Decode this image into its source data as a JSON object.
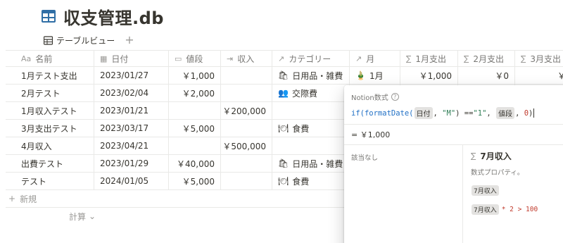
{
  "db": {
    "title": "収支管理.db",
    "icon": "table-icon"
  },
  "views": {
    "tab_label": "テーブルビュー",
    "add_label": "+"
  },
  "columns": [
    {
      "icon": "Aa",
      "label": "名前"
    },
    {
      "icon": "▦",
      "label": "日付"
    },
    {
      "icon": "▭",
      "label": "値段"
    },
    {
      "icon": "⇥",
      "label": "収入"
    },
    {
      "icon": "↗",
      "label": "カテゴリー"
    },
    {
      "icon": "↗",
      "label": "月"
    },
    {
      "icon": "∑",
      "label": "1月支出"
    },
    {
      "icon": "∑",
      "label": "2月支出"
    },
    {
      "icon": "∑",
      "label": "3月支出"
    }
  ],
  "rows": [
    {
      "name": "1月テスト支出",
      "date": "2023/01/27",
      "price": "￥1,000",
      "income": "",
      "category": "日用品・雑費",
      "category_emoji": "🛍",
      "month": "1月",
      "month_emoji": "🎍",
      "sum1": "￥1,000",
      "sum2": "￥0",
      "sum3": "￥"
    },
    {
      "name": "2月テスト",
      "date": "2023/02/04",
      "price": "￥2,000",
      "income": "",
      "category": "交際費",
      "category_emoji": "👥",
      "month": "",
      "month_emoji": "",
      "sum1": "",
      "sum2": "",
      "sum3": ""
    },
    {
      "name": "1月収入テスト",
      "date": "2023/01/21",
      "price": "",
      "income": "￥200,000",
      "category": "",
      "category_emoji": "",
      "month": "",
      "month_emoji": "",
      "sum1": "",
      "sum2": "",
      "sum3": ""
    },
    {
      "name": "3月支出テスト",
      "date": "2023/03/17",
      "price": "￥5,000",
      "income": "",
      "category": "食費",
      "category_emoji": "🍽",
      "month": "",
      "month_emoji": "",
      "sum1": "",
      "sum2": "",
      "sum3": ""
    },
    {
      "name": "4月収入",
      "date": "2023/04/21",
      "price": "",
      "income": "￥500,000",
      "category": "",
      "category_emoji": "",
      "month": "",
      "month_emoji": "",
      "sum1": "",
      "sum2": "",
      "sum3": ""
    },
    {
      "name": "出費テスト",
      "date": "2023/01/29",
      "price": "￥40,000",
      "income": "",
      "category": "日用品・雑費",
      "category_emoji": "🛍",
      "month": "",
      "month_emoji": "",
      "sum1": "",
      "sum2": "",
      "sum3": ""
    },
    {
      "name": "テスト",
      "date": "2024/01/05",
      "price": "￥5,000",
      "income": "",
      "category": "食費",
      "category_emoji": "🍽",
      "month": "",
      "month_emoji": "",
      "sum1": "",
      "sum2": "",
      "sum3": ""
    }
  ],
  "new_row_label": "新規",
  "calc_label": "計算",
  "formula_popup": {
    "title": "Notion数式",
    "formula_parts": {
      "fn_if": "if(",
      "fn_format": "formatDate(",
      "prop_date": "日付",
      "str_m": "\"M\"",
      "eq": ") == ",
      "str_1": "\"1\"",
      "prop_price": "値段",
      "zero": "0",
      "close": ")"
    },
    "result": "= ￥1,000",
    "left_pane_text": "該当なし",
    "right_title": "7月収入",
    "right_desc": "数式プロパティ。",
    "example_chip": "7月収入",
    "example_expr": "* 2 > 100"
  },
  "colors": {
    "accent_blue": "#1f6fc5",
    "string_green": "#2e7d55",
    "number_red": "#c0392b"
  }
}
